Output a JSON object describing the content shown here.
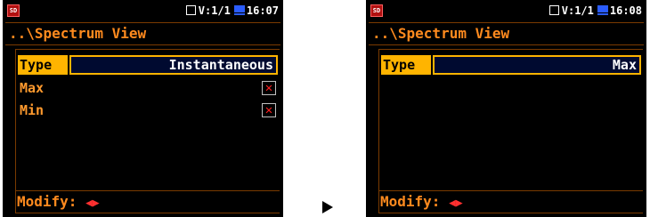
{
  "left": {
    "status": {
      "sd_label": "SD",
      "channel": "V:1/1",
      "time": "16:07"
    },
    "header": {
      "path": "..\\Spectrum View"
    },
    "type": {
      "label": "Type",
      "value": "Instantaneous"
    },
    "max": {
      "label": "Max",
      "checked": false
    },
    "min": {
      "label": "Min",
      "checked": false
    },
    "footer": {
      "text": "Modify:"
    }
  },
  "right": {
    "status": {
      "sd_label": "SD",
      "channel": "V:1/1",
      "time": "16:08"
    },
    "header": {
      "path": "..\\Spectrum View"
    },
    "type": {
      "label": "Type",
      "value": "Max"
    },
    "footer": {
      "text": "Modify:"
    }
  },
  "icons": {
    "arrow_left": "◀",
    "arrow_right": "▶",
    "unchecked_mark": "✕",
    "transition": "arrow-right-icon"
  }
}
